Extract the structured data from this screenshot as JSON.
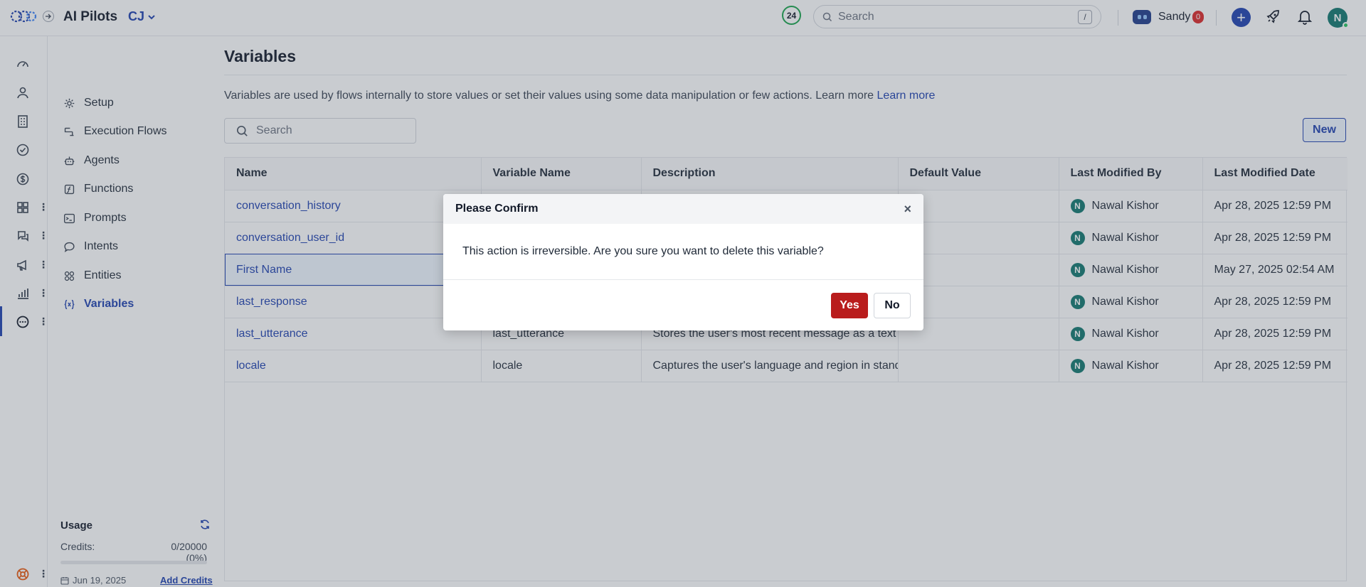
{
  "header": {
    "app_title": "AI Pilots",
    "workspace": "CJ",
    "counter": "24",
    "search_placeholder": "Search",
    "search_shortcut": "/",
    "user_name": "Sandy",
    "user_badge": "0",
    "avatar_initial": "N"
  },
  "rail": {
    "icons": [
      "speedometer-icon",
      "user-icon",
      "building-icon",
      "check-circle-icon",
      "dollar-icon",
      "apps-icon",
      "chat-icon",
      "megaphone-icon",
      "bar-chart-icon",
      "more-circle-icon"
    ],
    "bottom_icon": "lifebuoy-icon"
  },
  "sidebar": {
    "items": [
      {
        "label": "Setup",
        "icon": "gear-icon"
      },
      {
        "label": "Execution Flows",
        "icon": "flow-icon"
      },
      {
        "label": "Agents",
        "icon": "agent-icon"
      },
      {
        "label": "Functions",
        "icon": "function-icon"
      },
      {
        "label": "Prompts",
        "icon": "terminal-icon"
      },
      {
        "label": "Intents",
        "icon": "speech-bubble-icon"
      },
      {
        "label": "Entities",
        "icon": "entities-icon"
      },
      {
        "label": "Variables",
        "icon": "variable-icon",
        "active": true
      }
    ],
    "usage": {
      "title": "Usage",
      "credits_label": "Credits:",
      "credits_value": "0/20000 (0%)",
      "credits_fraction": 0,
      "date": "Jun 19, 2025",
      "add_credits": "Add Credits"
    }
  },
  "main": {
    "title": "Variables",
    "description": "Variables are used by flows internally to store values or set their values using some data manipulation or few actions. Learn more",
    "learn_more": "Learn more",
    "search_placeholder": "Search",
    "new_button": "New",
    "table": {
      "columns": [
        "Name",
        "Variable Name",
        "Description",
        "Default Value",
        "Last Modified By",
        "Last Modified Date"
      ],
      "rows": [
        {
          "name": "conversation_history",
          "variable": "",
          "description": "",
          "default": "",
          "modified_by": "Nawal Kishor",
          "date": "Apr 28, 2025 12:59 PM"
        },
        {
          "name": "conversation_user_id",
          "variable": "",
          "description": "",
          "default": "",
          "modified_by": "Nawal Kishor",
          "date": "Apr 28, 2025 12:59 PM"
        },
        {
          "name": "First Name",
          "variable": "",
          "description": "",
          "default": "",
          "modified_by": "Nawal Kishor",
          "date": "May 27, 2025 02:54 AM",
          "selected": true
        },
        {
          "name": "last_response",
          "variable": "",
          "description": "",
          "default": "",
          "modified_by": "Nawal Kishor",
          "date": "Apr 28, 2025 12:59 PM"
        },
        {
          "name": "last_utterance",
          "variable": "last_utterance",
          "description": "Stores the user's most recent message as a text st",
          "default": "",
          "modified_by": "Nawal Kishor",
          "date": "Apr 28, 2025 12:59 PM"
        },
        {
          "name": "locale",
          "variable": "locale",
          "description": "Captures the user's language and region in standa",
          "default": "",
          "modified_by": "Nawal Kishor",
          "date": "Apr 28, 2025 12:59 PM"
        }
      ]
    }
  },
  "modal": {
    "title": "Please Confirm",
    "close": "×",
    "message": "This action is irreversible. Are you sure you want to delete this variable?",
    "yes": "Yes",
    "no": "No"
  },
  "colors": {
    "accent": "#1e40af",
    "danger": "#b91c1c",
    "avatar": "#0f766e"
  }
}
